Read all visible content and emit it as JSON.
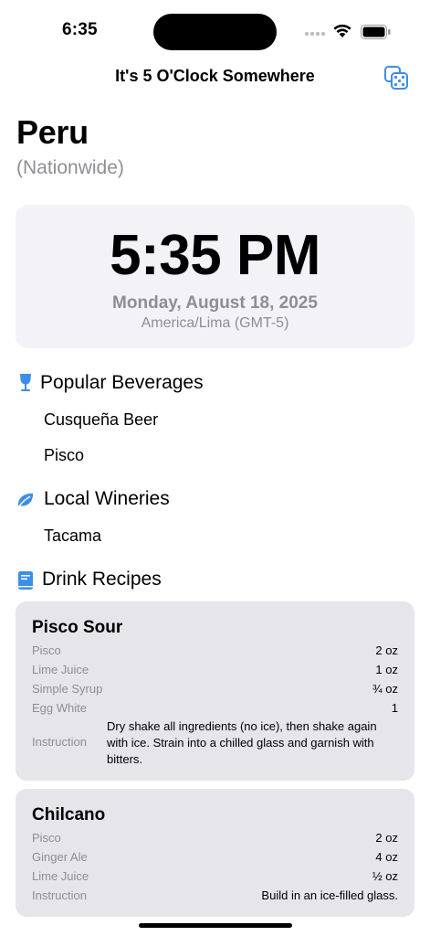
{
  "status_bar": {
    "time": "6:35"
  },
  "nav": {
    "title": "It's 5 O'Clock Somewhere",
    "shuffle_icon": "dice-icon"
  },
  "location": {
    "country": "Peru",
    "region": "(Nationwide)"
  },
  "clock": {
    "time": "5:35 PM",
    "date": "Monday, August 18, 2025",
    "timezone": "America/Lima (GMT-5)"
  },
  "sections": {
    "beverages": {
      "title": "Popular Beverages",
      "icon": "wine-glass-icon",
      "items": [
        "Cusqueña Beer",
        "Pisco"
      ]
    },
    "wineries": {
      "title": "Local Wineries",
      "icon": "leaf-icon",
      "items": [
        "Tacama"
      ]
    },
    "recipes": {
      "title": "Drink Recipes",
      "icon": "book-icon"
    }
  },
  "recipes": [
    {
      "name": "Pisco Sour",
      "ingredients": [
        {
          "label": "Pisco",
          "value": "2 oz"
        },
        {
          "label": "Lime Juice",
          "value": "1 oz"
        },
        {
          "label": "Simple Syrup",
          "value": "¾ oz"
        },
        {
          "label": "Egg White",
          "value": "1"
        }
      ],
      "instruction_label": "Instruction",
      "instruction": "Dry shake all ingredients (no ice), then shake again with ice. Strain into a chilled glass and garnish with bitters."
    },
    {
      "name": "Chilcano",
      "ingredients": [
        {
          "label": "Pisco",
          "value": "2 oz"
        },
        {
          "label": "Ginger Ale",
          "value": "4 oz"
        },
        {
          "label": "Lime Juice",
          "value": "½ oz"
        }
      ],
      "instruction_label": "Instruction",
      "instruction": "Build in an ice-filled glass."
    }
  ],
  "colors": {
    "accent": "#3d8ee6",
    "card": "#f2f2f7",
    "recipe_card": "#e5e5ea",
    "secondary_text": "#8e8e93"
  }
}
